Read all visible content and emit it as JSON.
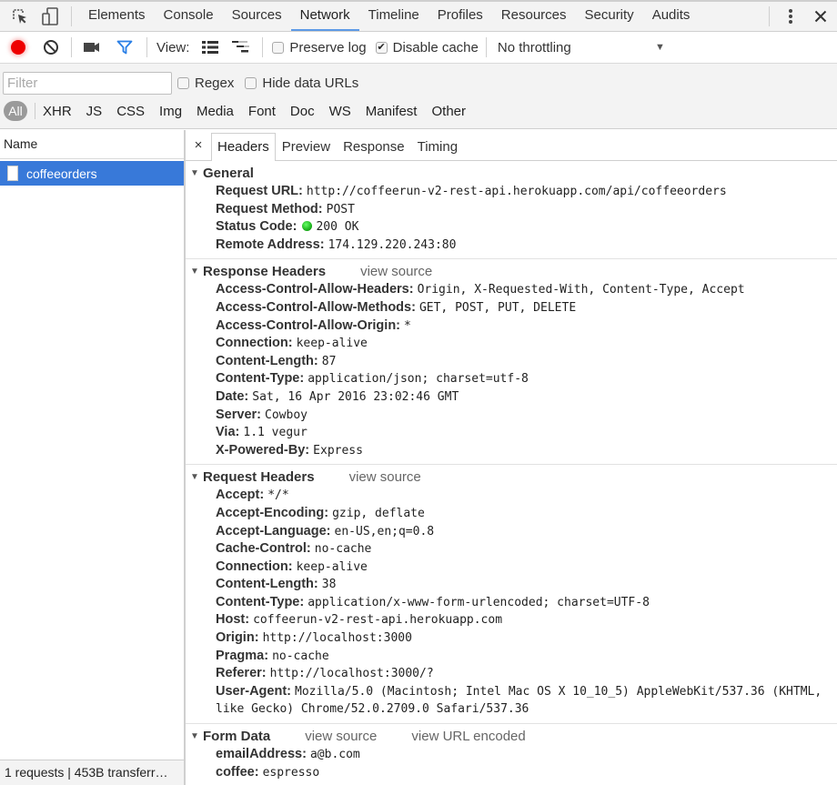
{
  "main_tabs": {
    "tabs": [
      {
        "label": "Elements",
        "active": false
      },
      {
        "label": "Console",
        "active": false
      },
      {
        "label": "Sources",
        "active": false
      },
      {
        "label": "Network",
        "active": true
      },
      {
        "label": "Timeline",
        "active": false
      },
      {
        "label": "Profiles",
        "active": false
      },
      {
        "label": "Resources",
        "active": false
      },
      {
        "label": "Security",
        "active": false
      },
      {
        "label": "Audits",
        "active": false
      }
    ],
    "icons": {
      "inspect": "inspect-element-icon",
      "device": "device-mode-icon",
      "more": "more-vertical-icon",
      "close": "close-icon"
    }
  },
  "toolbar": {
    "record_color": "#e00000",
    "view_label": "View:",
    "preserve_log": {
      "label": "Preserve log",
      "checked": false
    },
    "disable_cache": {
      "label": "Disable cache",
      "checked": true
    },
    "throttling": {
      "value": "No throttling"
    }
  },
  "filter": {
    "placeholder": "Filter",
    "value": "",
    "regex": {
      "label": "Regex",
      "checked": false
    },
    "hide_data_urls": {
      "label": "Hide data URLs",
      "checked": false
    },
    "types": [
      "All",
      "XHR",
      "JS",
      "CSS",
      "Img",
      "Media",
      "Font",
      "Doc",
      "WS",
      "Manifest",
      "Other"
    ],
    "active_type": "All"
  },
  "requests": {
    "column_header": "Name",
    "items": [
      {
        "name": "coffeeorders",
        "selected": true
      }
    ],
    "status_text": "1 requests | 453B transferr…",
    "selection_color": "#3879d9"
  },
  "detail": {
    "close_glyph": "×",
    "tabs": [
      {
        "label": "Headers",
        "active": true
      },
      {
        "label": "Preview",
        "active": false
      },
      {
        "label": "Response",
        "active": false
      },
      {
        "label": "Timing",
        "active": false
      }
    ],
    "general": {
      "title": "General",
      "request_url": {
        "key": "Request URL:",
        "value": "http://coffeerun-v2-rest-api.herokuapp.com/api/coffeeorders"
      },
      "request_method": {
        "key": "Request Method:",
        "value": "POST"
      },
      "status_code": {
        "key": "Status Code:",
        "value": "200 OK",
        "color": "#1db31d"
      },
      "remote_address": {
        "key": "Remote Address:",
        "value": "174.129.220.243:80"
      }
    },
    "response_headers": {
      "title": "Response Headers",
      "view_source": "view source",
      "rows": [
        {
          "key": "Access-Control-Allow-Headers:",
          "value": "Origin, X-Requested-With, Content-Type, Accept"
        },
        {
          "key": "Access-Control-Allow-Methods:",
          "value": "GET, POST, PUT, DELETE"
        },
        {
          "key": "Access-Control-Allow-Origin:",
          "value": "*"
        },
        {
          "key": "Connection:",
          "value": "keep-alive"
        },
        {
          "key": "Content-Length:",
          "value": "87"
        },
        {
          "key": "Content-Type:",
          "value": "application/json; charset=utf-8"
        },
        {
          "key": "Date:",
          "value": "Sat, 16 Apr 2016 23:02:46 GMT"
        },
        {
          "key": "Server:",
          "value": "Cowboy"
        },
        {
          "key": "Via:",
          "value": "1.1 vegur"
        },
        {
          "key": "X-Powered-By:",
          "value": "Express"
        }
      ]
    },
    "request_headers": {
      "title": "Request Headers",
      "view_source": "view source",
      "rows": [
        {
          "key": "Accept:",
          "value": "*/*"
        },
        {
          "key": "Accept-Encoding:",
          "value": "gzip, deflate"
        },
        {
          "key": "Accept-Language:",
          "value": "en-US,en;q=0.8"
        },
        {
          "key": "Cache-Control:",
          "value": "no-cache"
        },
        {
          "key": "Connection:",
          "value": "keep-alive"
        },
        {
          "key": "Content-Length:",
          "value": "38"
        },
        {
          "key": "Content-Type:",
          "value": "application/x-www-form-urlencoded; charset=UTF-8"
        },
        {
          "key": "Host:",
          "value": "coffeerun-v2-rest-api.herokuapp.com"
        },
        {
          "key": "Origin:",
          "value": "http://localhost:3000"
        },
        {
          "key": "Pragma:",
          "value": "no-cache"
        },
        {
          "key": "Referer:",
          "value": "http://localhost:3000/?"
        },
        {
          "key": "User-Agent:",
          "value": "Mozilla/5.0 (Macintosh; Intel Mac OS X 10_10_5) AppleWebKit/537.36 (KHTML, like Gecko) Chrome/52.0.2709.0 Safari/537.36"
        }
      ]
    },
    "form_data": {
      "title": "Form Data",
      "view_source": "view source",
      "view_url_encoded": "view URL encoded",
      "rows": [
        {
          "key": "emailAddress:",
          "value": "a@b.com"
        },
        {
          "key": "coffee:",
          "value": "espresso"
        }
      ]
    }
  }
}
